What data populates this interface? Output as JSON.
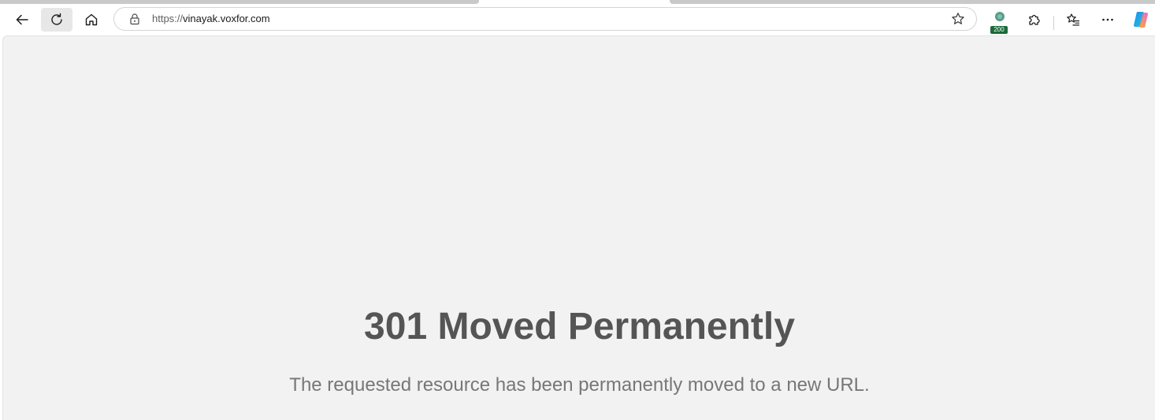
{
  "browser": {
    "url_scheme": "https://",
    "url_host": "vinayak.voxfor.com",
    "extension_badge_count": "200",
    "icons": {
      "back": "back-arrow-icon",
      "refresh": "refresh-icon",
      "home": "home-icon",
      "lock": "lock-icon",
      "favorite": "star-icon",
      "extension_status": "status-extension-icon",
      "extensions": "puzzle-icon",
      "favorites": "favorites-list-icon",
      "more": "more-ellipsis-icon",
      "copilot": "copilot-icon"
    }
  },
  "page": {
    "heading": "301 Moved Permanently",
    "message": "The requested resource has been permanently moved to a new URL."
  },
  "colors": {
    "page_background": "#f2f2f2",
    "heading": "#555555",
    "message": "#777777",
    "badge": "#1c6b3a"
  }
}
